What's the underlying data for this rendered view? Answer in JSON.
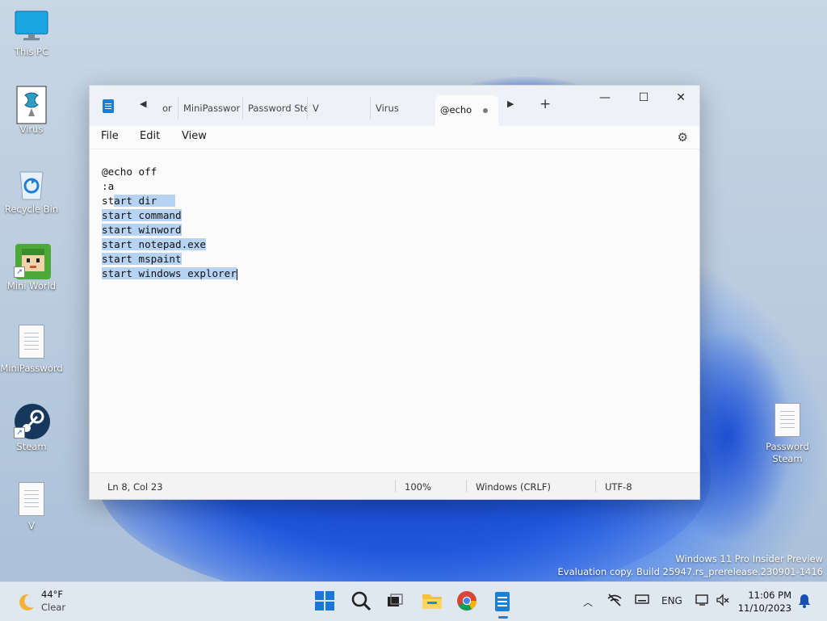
{
  "desktop": {
    "icons": [
      {
        "label": "This PC",
        "icon": "monitor-icon"
      },
      {
        "label": "Virus",
        "icon": "batch-file-icon"
      },
      {
        "label": "Recycle Bin",
        "icon": "recycle-bin-icon"
      },
      {
        "label": "Mini World",
        "icon": "game-icon"
      },
      {
        "label": "MiniPassword",
        "icon": "text-file-icon"
      },
      {
        "label": "Steam",
        "icon": "steam-icon"
      },
      {
        "label": "V",
        "icon": "text-file-icon"
      },
      {
        "label": "Password Steam",
        "icon": "text-file-icon"
      }
    ]
  },
  "notepad": {
    "tabs": [
      "or",
      "MiniPasswor",
      "Password Ste",
      "V",
      "Virus",
      "@echo"
    ],
    "active_tab": "@echo",
    "add_tab": "+",
    "controls": {
      "minimize": "—",
      "maximize": "☐",
      "close": "✕"
    },
    "menu": {
      "file": "File",
      "edit": "Edit",
      "view": "View"
    },
    "lines": [
      "@echo off",
      ":a",
      "start dir",
      "start command",
      "start winword",
      "start notepad.exe",
      "start mspaint",
      "start windows explorer"
    ],
    "status": {
      "position": "Ln 8, Col 23",
      "zoom": "100%",
      "line_ending": "Windows (CRLF)",
      "encoding": "UTF-8"
    }
  },
  "watermark": {
    "line1": "Windows 11 Pro Insider Preview",
    "line2": "Evaluation copy. Build 25947.rs_prerelease.230901-1416"
  },
  "taskbar": {
    "weather": {
      "temp": "44°F",
      "condition": "Clear"
    },
    "language": "ENG",
    "time": "11:06 PM",
    "date": "11/10/2023"
  },
  "colors": {
    "selection": "#b6d3f3",
    "accent": "#1b7fd4"
  }
}
